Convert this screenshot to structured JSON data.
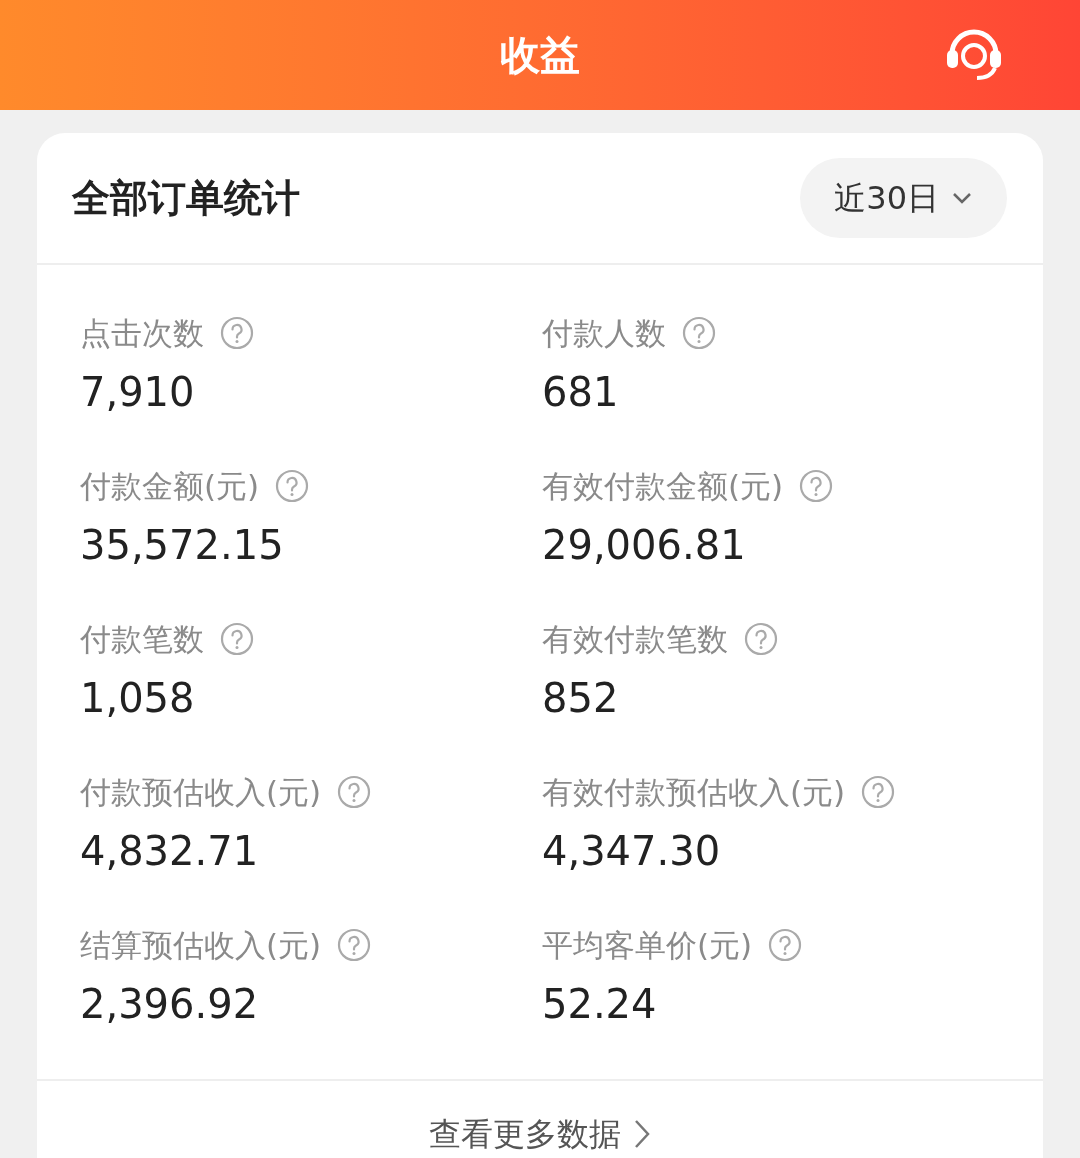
{
  "header": {
    "title": "收益"
  },
  "card": {
    "title": "全部订单统计",
    "range": "近30日",
    "metrics": [
      {
        "label": "点击次数",
        "value": "7,910"
      },
      {
        "label": "付款人数",
        "value": "681"
      },
      {
        "label": "付款金额(元)",
        "value": "35,572.15"
      },
      {
        "label": "有效付款金额(元)",
        "value": "29,006.81"
      },
      {
        "label": "付款笔数",
        "value": "1,058"
      },
      {
        "label": "有效付款笔数",
        "value": "852"
      },
      {
        "label": "付款预估收入(元)",
        "value": "4,832.71"
      },
      {
        "label": "有效付款预估收入(元)",
        "value": "4,347.30"
      },
      {
        "label": "结算预估收入(元)",
        "value": "2,396.92"
      },
      {
        "label": "平均客单价(元)",
        "value": "52.24"
      }
    ],
    "more": "查看更多数据"
  }
}
